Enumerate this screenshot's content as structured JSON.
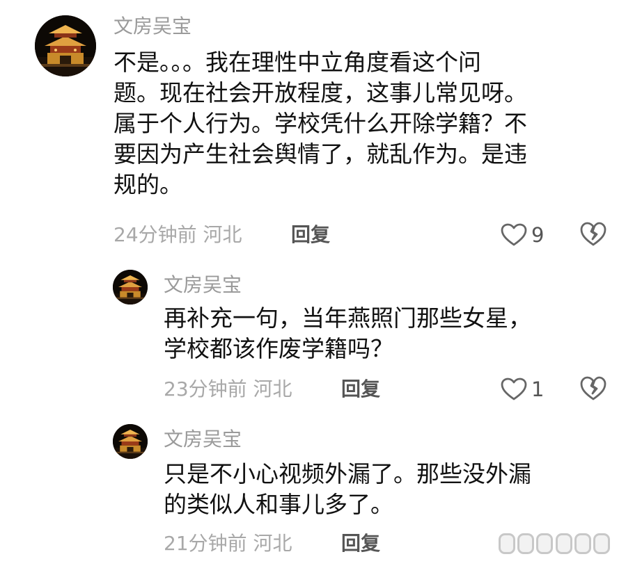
{
  "comments": [
    {
      "username": "文房吴宝",
      "text_lines": [
        "不是。。。我在理性中立角度看这个问",
        "题。现在社会开放程度，这事儿常见呀。",
        "属于个人行为。学校凭什么开除学籍？不",
        "要因为产生社会舆情了，就乱作为。是违",
        "规的。"
      ],
      "time": "24分钟前",
      "location": "河北",
      "reply_label": "回复",
      "like_count": "9",
      "icons": {
        "like": "heart-outline-icon",
        "dislike": "broken-heart-icon"
      }
    },
    {
      "username": "文房吴宝",
      "text_lines": [
        "再补充一句，当年燕照门那些女星，",
        "学校都该作废学籍吗？"
      ],
      "time": "23分钟前",
      "location": "河北",
      "reply_label": "回复",
      "like_count": "1",
      "icons": {
        "like": "heart-outline-icon",
        "dislike": "broken-heart-icon"
      }
    },
    {
      "username": "文房吴宝",
      "text_lines": [
        "只是不小心视频外漏了。那些没外漏",
        "的类似人和事儿多了。"
      ],
      "time": "21分钟前",
      "location": "河北",
      "reply_label": "回复",
      "like_count": "",
      "icons": {
        "like": "heart-outline-icon",
        "dislike": "broken-heart-icon"
      }
    }
  ],
  "colors": {
    "username": "#9a9a9a",
    "meta": "#a8a8a8",
    "reply": "#555555",
    "text": "#111111",
    "icon": "#666666"
  }
}
